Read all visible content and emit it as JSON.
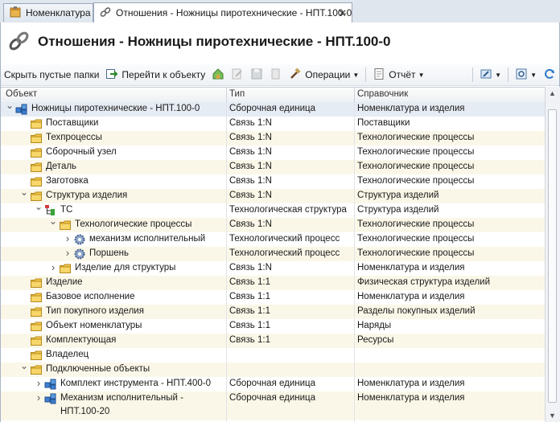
{
  "tabs": [
    {
      "label": "Номенклатура",
      "icon": "nomenclature-icon"
    },
    {
      "label": "Отношения - Ножницы пиротехнические - НПТ.100-0",
      "icon": "chain-link-icon"
    }
  ],
  "header": {
    "title": "Отношения - Ножницы пиротехнические - НПТ.100-0"
  },
  "toolbar": {
    "hide_empty": "Скрыть пустые папки",
    "goto_object": "Перейти к объекту",
    "operations": "Операции",
    "report": "Отчёт"
  },
  "columns": {
    "object": "Объект",
    "type": "Тип",
    "reference": "Справочник"
  },
  "rows": [
    {
      "level": 0,
      "expander": "open",
      "icon": "assembly",
      "name": "Ножницы пиротехнические - НПТ.100-0",
      "type": "Сборочная единица",
      "ref": "Номенклатура и изделия"
    },
    {
      "level": 1,
      "expander": "",
      "icon": "folder",
      "name": "Поставщики",
      "type": "Связь 1:N",
      "ref": "Поставщики"
    },
    {
      "level": 1,
      "expander": "",
      "icon": "folder",
      "name": "Техпроцессы",
      "type": "Связь 1:N",
      "ref": "Технологические процессы"
    },
    {
      "level": 1,
      "expander": "",
      "icon": "folder",
      "name": "Сборочный узел",
      "type": "Связь 1:N",
      "ref": "Технологические процессы"
    },
    {
      "level": 1,
      "expander": "",
      "icon": "folder",
      "name": "Деталь",
      "type": "Связь 1:N",
      "ref": "Технологические процессы"
    },
    {
      "level": 1,
      "expander": "",
      "icon": "folder",
      "name": "Заготовка",
      "type": "Связь 1:N",
      "ref": "Технологические процессы"
    },
    {
      "level": 1,
      "expander": "open",
      "icon": "folder",
      "name": "Структура изделия",
      "type": "Связь 1:N",
      "ref": "Структура изделий"
    },
    {
      "level": 2,
      "expander": "open",
      "icon": "tree",
      "name": "ТС",
      "type": "Технологическая структура",
      "ref": "Структура изделий"
    },
    {
      "level": 3,
      "expander": "open",
      "icon": "folder",
      "name": "Технологические процессы",
      "type": "Связь 1:N",
      "ref": "Технологические процессы"
    },
    {
      "level": 4,
      "expander": "closed",
      "icon": "gear",
      "name": "механизм исполнительный",
      "type": "Технологический процесс",
      "ref": "Технологические процессы"
    },
    {
      "level": 4,
      "expander": "closed",
      "icon": "gear",
      "name": "Поршень",
      "type": "Технологический процесс",
      "ref": "Технологические процессы"
    },
    {
      "level": 3,
      "expander": "closed",
      "icon": "folder",
      "name": "Изделие для структуры",
      "type": "Связь 1:N",
      "ref": "Номенклатура и изделия"
    },
    {
      "level": 1,
      "expander": "",
      "icon": "folder",
      "name": "Изделие",
      "type": "Связь 1:1",
      "ref": "Физическая структура изделий"
    },
    {
      "level": 1,
      "expander": "",
      "icon": "folder",
      "name": "Базовое исполнение",
      "type": "Связь 1:1",
      "ref": "Номенклатура и изделия"
    },
    {
      "level": 1,
      "expander": "",
      "icon": "folder",
      "name": "Тип покупного изделия",
      "type": "Связь 1:1",
      "ref": "Разделы покупных изделий"
    },
    {
      "level": 1,
      "expander": "",
      "icon": "folder",
      "name": "Объект номенклатуры",
      "type": "Связь 1:1",
      "ref": "Наряды"
    },
    {
      "level": 1,
      "expander": "",
      "icon": "folder",
      "name": "Комплектующая",
      "type": "Связь 1:1",
      "ref": "Ресурсы"
    },
    {
      "level": 1,
      "expander": "",
      "icon": "folder",
      "name": "Владелец",
      "type": "",
      "ref": ""
    },
    {
      "level": 1,
      "expander": "open",
      "icon": "folder",
      "name": "Подключенные объекты",
      "type": "",
      "ref": ""
    },
    {
      "level": 2,
      "expander": "closed",
      "icon": "assembly",
      "name": "Комплект инструмента - НПТ.400-0",
      "type": "Сборочная единица",
      "ref": "Номенклатура и изделия"
    },
    {
      "level": 2,
      "expander": "closed",
      "icon": "assembly",
      "name": "Механизм исполнительный -",
      "name2": "НПТ.100-20",
      "type": "Сборочная единица",
      "ref": "Номенклатура и изделия"
    }
  ]
}
